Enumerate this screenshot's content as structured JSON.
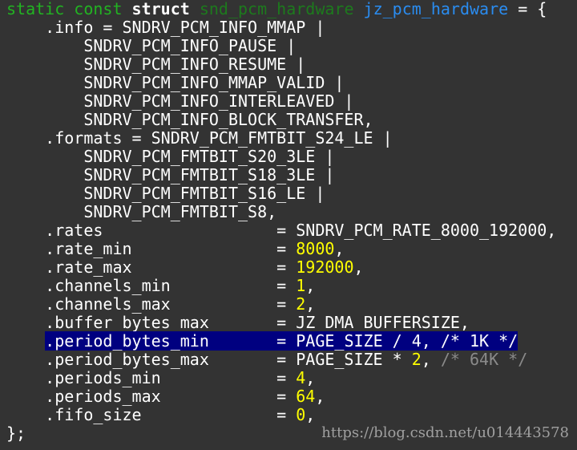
{
  "code_lines": [
    {
      "tokens": [
        [
          "static ",
          "kw"
        ],
        [
          "const ",
          "kw"
        ],
        [
          "struct ",
          "bold"
        ],
        [
          "snd_pcm_hardware ",
          "type"
        ],
        [
          "jz_pcm_hardware",
          "ident"
        ],
        [
          " = {",
          "plain"
        ]
      ]
    },
    {
      "tokens": [
        [
          "    .info = SNDRV_PCM_INFO_MMAP |",
          "plain"
        ]
      ]
    },
    {
      "tokens": [
        [
          "        SNDRV_PCM_INFO_PAUSE |",
          "plain"
        ]
      ]
    },
    {
      "tokens": [
        [
          "        SNDRV_PCM_INFO_RESUME |",
          "plain"
        ]
      ]
    },
    {
      "tokens": [
        [
          "        SNDRV_PCM_INFO_MMAP_VALID |",
          "plain"
        ]
      ]
    },
    {
      "tokens": [
        [
          "        SNDRV_PCM_INFO_INTERLEAVED |",
          "plain"
        ]
      ]
    },
    {
      "tokens": [
        [
          "        SNDRV_PCM_INFO_BLOCK_TRANSFER,",
          "plain"
        ]
      ]
    },
    {
      "tokens": [
        [
          "    .formats = SNDRV_PCM_FMTBIT_S24_LE |",
          "plain"
        ]
      ]
    },
    {
      "tokens": [
        [
          "        SNDRV_PCM_FMTBIT_S20_3LE |",
          "plain"
        ]
      ]
    },
    {
      "tokens": [
        [
          "        SNDRV_PCM_FMTBIT_S18_3LE |",
          "plain"
        ]
      ]
    },
    {
      "tokens": [
        [
          "        SNDRV_PCM_FMTBIT_S16_LE |",
          "plain"
        ]
      ]
    },
    {
      "tokens": [
        [
          "        SNDRV_PCM_FMTBIT_S8,",
          "plain"
        ]
      ]
    },
    {
      "tokens": [
        [
          "    .rates                  = SNDRV_PCM_RATE_8000_192000,",
          "plain"
        ]
      ]
    },
    {
      "tokens": [
        [
          "    .rate_min               = ",
          "plain"
        ],
        [
          "8000",
          "num"
        ],
        [
          ",",
          "plain"
        ]
      ]
    },
    {
      "tokens": [
        [
          "    .rate_max               = ",
          "plain"
        ],
        [
          "192000",
          "num"
        ],
        [
          ",",
          "plain"
        ]
      ]
    },
    {
      "tokens": [
        [
          "    .channels_min           = ",
          "plain"
        ],
        [
          "1",
          "num"
        ],
        [
          ",",
          "plain"
        ]
      ]
    },
    {
      "tokens": [
        [
          "    .channels_max           = ",
          "plain"
        ],
        [
          "2",
          "num"
        ],
        [
          ",",
          "plain"
        ]
      ]
    },
    {
      "tokens": [
        [
          "    .buffer_bytes_max       = JZ_DMA_BUFFERSIZE,",
          "plain"
        ]
      ]
    },
    {
      "tokens": [
        [
          "    ",
          "plain"
        ],
        [
          ".period_bytes_min       = PAGE_SIZE / 4, /* 1K */",
          "plain hl"
        ]
      ]
    },
    {
      "tokens": [
        [
          "    .period_bytes_max       = PAGE_SIZE * ",
          "plain"
        ],
        [
          "2",
          "num"
        ],
        [
          ", ",
          "plain"
        ],
        [
          "/* 64K */",
          "cmt"
        ]
      ]
    },
    {
      "tokens": [
        [
          "    .periods_min            = ",
          "plain"
        ],
        [
          "4",
          "num"
        ],
        [
          ",",
          "plain"
        ]
      ]
    },
    {
      "tokens": [
        [
          "    .periods_max            = ",
          "plain"
        ],
        [
          "64",
          "num"
        ],
        [
          ",",
          "plain"
        ]
      ]
    },
    {
      "tokens": [
        [
          "    .fifo_size              = ",
          "plain"
        ],
        [
          "0",
          "num"
        ],
        [
          ",",
          "plain"
        ]
      ]
    },
    {
      "tokens": [
        [
          "};",
          "plain"
        ]
      ]
    }
  ],
  "watermark": "https://blog.csdn.net/u014443578"
}
